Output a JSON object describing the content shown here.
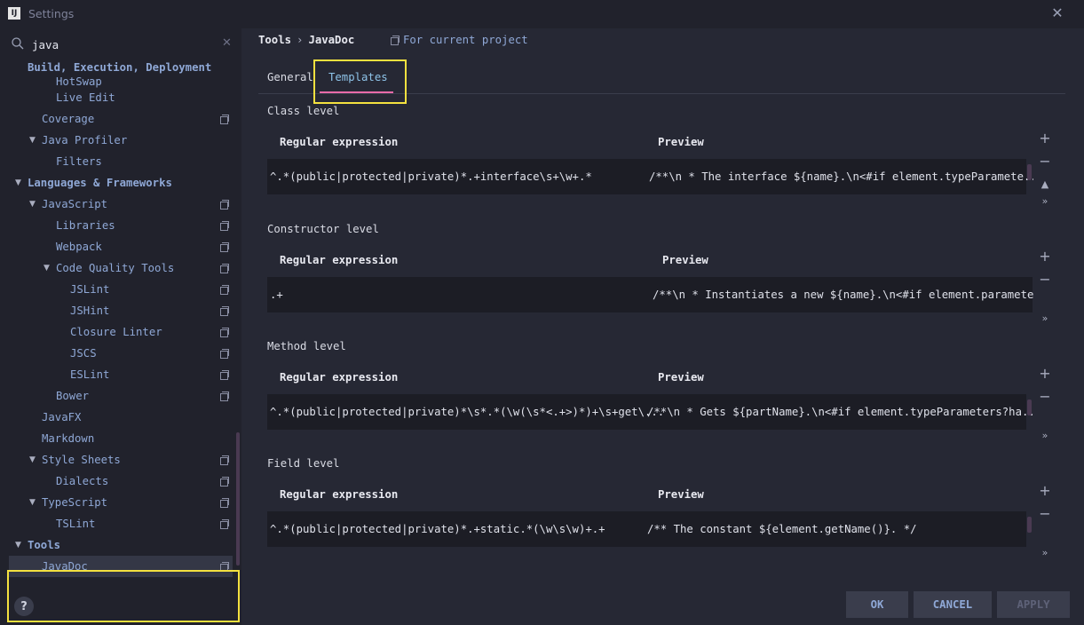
{
  "window": {
    "title": "Settings",
    "app_icon_text": "IJ"
  },
  "search": {
    "value": "java",
    "placeholder": ""
  },
  "tree": [
    {
      "label": "Build, Execution, Deployment",
      "bold": true
    },
    {
      "label": "HotSwap"
    },
    {
      "label": "Live Edit"
    },
    {
      "label": "Coverage",
      "project": true
    },
    {
      "label": "Java Profiler",
      "expanded": true
    },
    {
      "label": "Filters"
    },
    {
      "label": "Languages & Frameworks",
      "bold": true,
      "expanded": true
    },
    {
      "label": "JavaScript",
      "expanded": true,
      "project": true
    },
    {
      "label": "Libraries",
      "project": true
    },
    {
      "label": "Webpack",
      "project": true
    },
    {
      "label": "Code Quality Tools",
      "expanded": true,
      "project": true
    },
    {
      "label": "JSLint",
      "project": true
    },
    {
      "label": "JSHint",
      "project": true
    },
    {
      "label": "Closure Linter",
      "project": true
    },
    {
      "label": "JSCS",
      "project": true
    },
    {
      "label": "ESLint",
      "project": true
    },
    {
      "label": "Bower",
      "project": true
    },
    {
      "label": "JavaFX"
    },
    {
      "label": "Markdown"
    },
    {
      "label": "Style Sheets",
      "expanded": true,
      "project": true
    },
    {
      "label": "Dialects",
      "project": true
    },
    {
      "label": "TypeScript",
      "expanded": true,
      "project": true
    },
    {
      "label": "TSLint",
      "project": true
    },
    {
      "label": "Tools",
      "bold": true,
      "expanded": true
    },
    {
      "label": "JavaDoc",
      "project": true,
      "selected": true
    }
  ],
  "breadcrumb": {
    "parent": "Tools",
    "separator": "›",
    "current": "JavaDoc"
  },
  "scope_label": "For current project",
  "tabs": {
    "general": "General",
    "templates": "Templates",
    "active": "templates"
  },
  "sections": {
    "class": {
      "title": "Class level",
      "col_regex": "Regular expression",
      "col_preview": "Preview",
      "regex": "^.*(public|protected|private)*.+interface\\s+\\w+.*",
      "preview": "/**\\n * The interface ${name}.\\n<#if element.typeParamete..."
    },
    "constructor": {
      "title": "Constructor level",
      "col_regex": "Regular expression",
      "col_preview": "Preview",
      "regex": ".+",
      "preview": "/**\\n * Instantiates a new ${name}.\\n<#if element.paramete..."
    },
    "method": {
      "title": "Method level",
      "col_regex": "Regular expression",
      "col_preview": "Preview",
      "regex": "^.*(public|protected|private)*\\s*.*(\\w(\\s*<.+>)*)+\\s+get\\...",
      "preview": "/**\\n * Gets ${partName}.\\n<#if element.typeParameters?ha..."
    },
    "field": {
      "title": "Field level",
      "col_regex": "Regular expression",
      "col_preview": "Preview",
      "regex": "^.*(public|protected|private)*.+static.*(\\w\\s\\w)+.+",
      "preview": "/** The constant ${element.getName()}. */"
    }
  },
  "side_buttons": {
    "add": "+",
    "remove": "−",
    "up": "▲",
    "more": "»"
  },
  "footer": {
    "ok": "OK",
    "cancel": "CANCEL",
    "apply": "APPLY",
    "help": "?"
  },
  "colors": {
    "accent_pink": "#e86aa8",
    "highlight_yellow": "#f4e13f",
    "link_blue": "#8fa8d6"
  }
}
